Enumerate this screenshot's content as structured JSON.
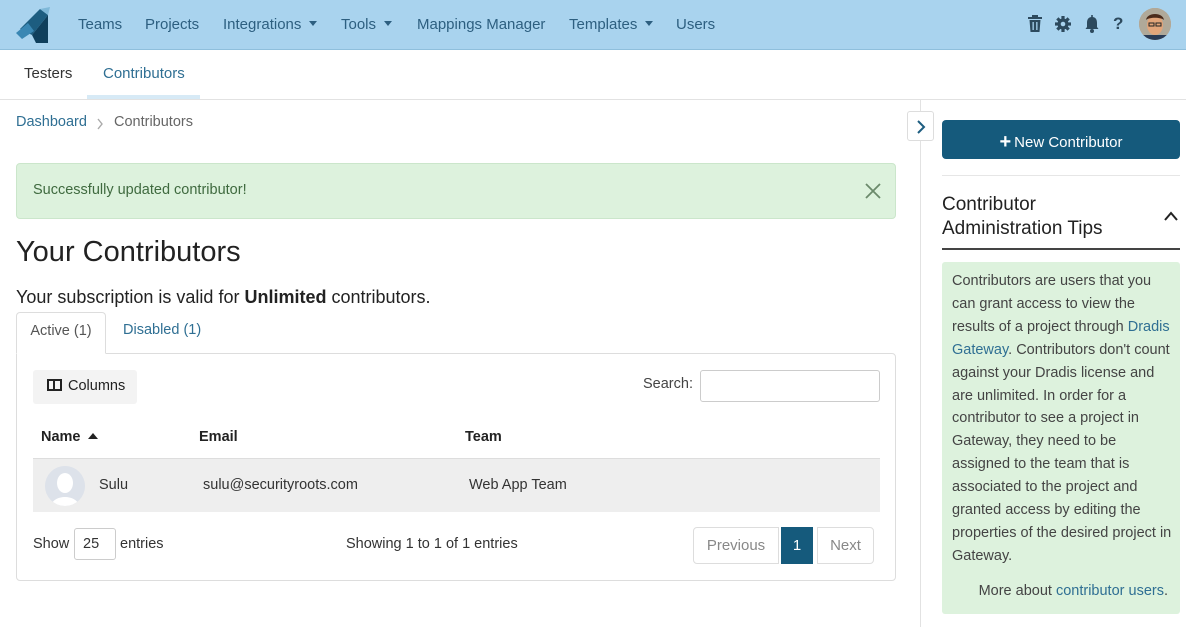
{
  "nav": {
    "items": [
      {
        "label": "Teams",
        "dropdown": false
      },
      {
        "label": "Projects",
        "dropdown": false
      },
      {
        "label": "Integrations",
        "dropdown": true
      },
      {
        "label": "Tools",
        "dropdown": true
      },
      {
        "label": "Mappings Manager",
        "dropdown": false
      },
      {
        "label": "Templates",
        "dropdown": true
      },
      {
        "label": "Users",
        "dropdown": false
      }
    ],
    "icons": [
      "trash-icon",
      "gear-icon",
      "bell-icon",
      "help-icon"
    ],
    "help_label": "?"
  },
  "subnav": {
    "tabs": [
      {
        "label": "Testers",
        "active": false
      },
      {
        "label": "Contributors",
        "active": true
      }
    ]
  },
  "breadcrumb": {
    "root": "Dashboard",
    "current": "Contributors"
  },
  "alert": {
    "message": "Successfully updated contributor!"
  },
  "page": {
    "title": "Your Contributors",
    "subscription_prefix": "Your subscription is valid for ",
    "subscription_bold": "Unlimited",
    "subscription_suffix": " contributors."
  },
  "tabs": {
    "active": "Active (1)",
    "disabled": "Disabled (1)"
  },
  "table": {
    "columns_button": "Columns",
    "search_label": "Search:",
    "search_value": "",
    "headers": [
      "Name",
      "Email",
      "Team"
    ],
    "sorted_column": "Name",
    "rows": [
      {
        "name": "Sulu",
        "email": "sulu@securityroots.com",
        "team": "Web App Team"
      }
    ],
    "show_label": "Show",
    "page_size": "25",
    "entries_label": "entries",
    "showing_text": "Showing 1 to 1 of 1 entries",
    "pagination": {
      "previous": "Previous",
      "current": "1",
      "next": "Next"
    }
  },
  "sidebar": {
    "new_button": "New Contributor",
    "tips_title": "Contributor Administration Tips",
    "tips_text_1": "Contributors are users that you can grant access to view the results of a project through ",
    "tips_link": "Dradis Gateway",
    "tips_text_2": ". Contributors don't count against your Dradis license and are unlimited. In order for a contributor to see a project in Gateway, they need to be assigned to the team that is associated to the project and granted access by editing the properties of the desired project in Gateway.",
    "more_prefix": "More about ",
    "more_link": "contributor users",
    "more_suffix": "."
  },
  "colors": {
    "nav_bg": "#a9d3ee",
    "primary": "#155a7c",
    "link": "#2f6f93",
    "success_bg": "#ddf2dd"
  }
}
